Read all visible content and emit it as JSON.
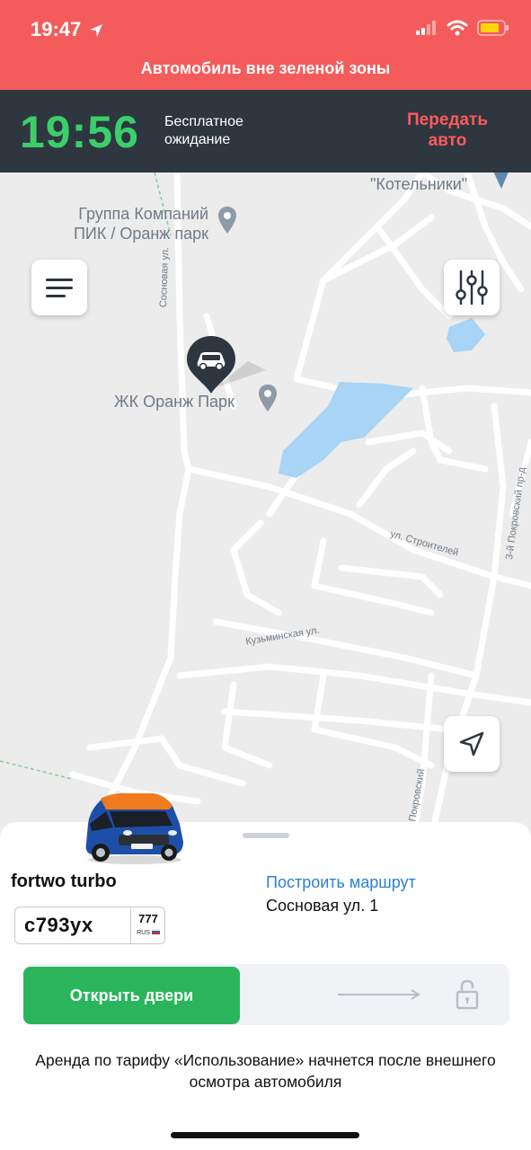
{
  "status_bar": {
    "time": "19:47",
    "location_icon": "location-arrow-icon",
    "signal_icon": "signal-icon",
    "wifi_icon": "wifi-icon",
    "battery_icon": "battery-icon",
    "battery_color": "#ffd60a"
  },
  "alert": {
    "text": "Автомобиль вне зеленой зоны",
    "color": "#f45c5c"
  },
  "timer_bar": {
    "timer": "19:56",
    "label": "Бесплатное ожидание",
    "transfer_button": "Передать авто",
    "timer_color": "#3bcf6a"
  },
  "map": {
    "pois": [
      {
        "name": "Группа Компаний ПИК / Оранж парк",
        "line1": "Группа Компаний",
        "line2": "ПИК / Оранж парк"
      },
      {
        "name": "ЖК Оранж Парк"
      },
      {
        "name": "\"Котельники\""
      }
    ],
    "streets": [
      "Сосновая ул.",
      "ул. Строителей",
      "Кузьминская ул.",
      "3-й Покровский пр-д",
      "3-й Покровский"
    ],
    "menu_button_icon": "menu-icon",
    "filter_button_icon": "filter-sliders-icon",
    "locate_button_icon": "navigation-arrow-icon",
    "car_marker_icon": "car-marker-icon",
    "water_color": "#a8d4f5"
  },
  "sheet": {
    "model": "fortwo turbo",
    "plate": {
      "number": "с793ух",
      "region": "777",
      "country": "RUS"
    },
    "route_link": "Построить маршрут",
    "address": "Сосновая ул. 1",
    "open_button": "Открыть двери",
    "lock_icon": "lock-icon",
    "note": "Аренда по тарифу «Использование» начнется после внешнего осмотра автомобиля"
  }
}
